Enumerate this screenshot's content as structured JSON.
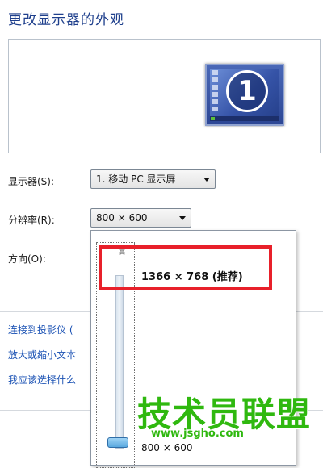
{
  "window": {
    "title": "更改显示器的外观"
  },
  "preview": {
    "monitor_number": "1"
  },
  "display": {
    "label": "显示器(S):",
    "value": "1. 移动 PC 显示屏"
  },
  "resolution": {
    "label": "分辨率(R):",
    "value": "800 × 600",
    "dropdown": {
      "slider_top_label": "高",
      "top_option": "1366 × 768 (推荐)",
      "bottom_option": "800 × 600",
      "slider_position_fraction": 1.0
    }
  },
  "orientation": {
    "label": "方向(O):"
  },
  "links": [
    "连接到投影仪 (",
    "放大或缩小文本",
    "我应该选择什么"
  ],
  "watermark": {
    "text": "技术员联盟",
    "url": "www.jsgho.com"
  },
  "colors": {
    "title_blue": "#1e3f8c",
    "link_blue": "#1b52b4",
    "highlight_red": "#e8202a",
    "watermark_green": "#2fb80f"
  }
}
